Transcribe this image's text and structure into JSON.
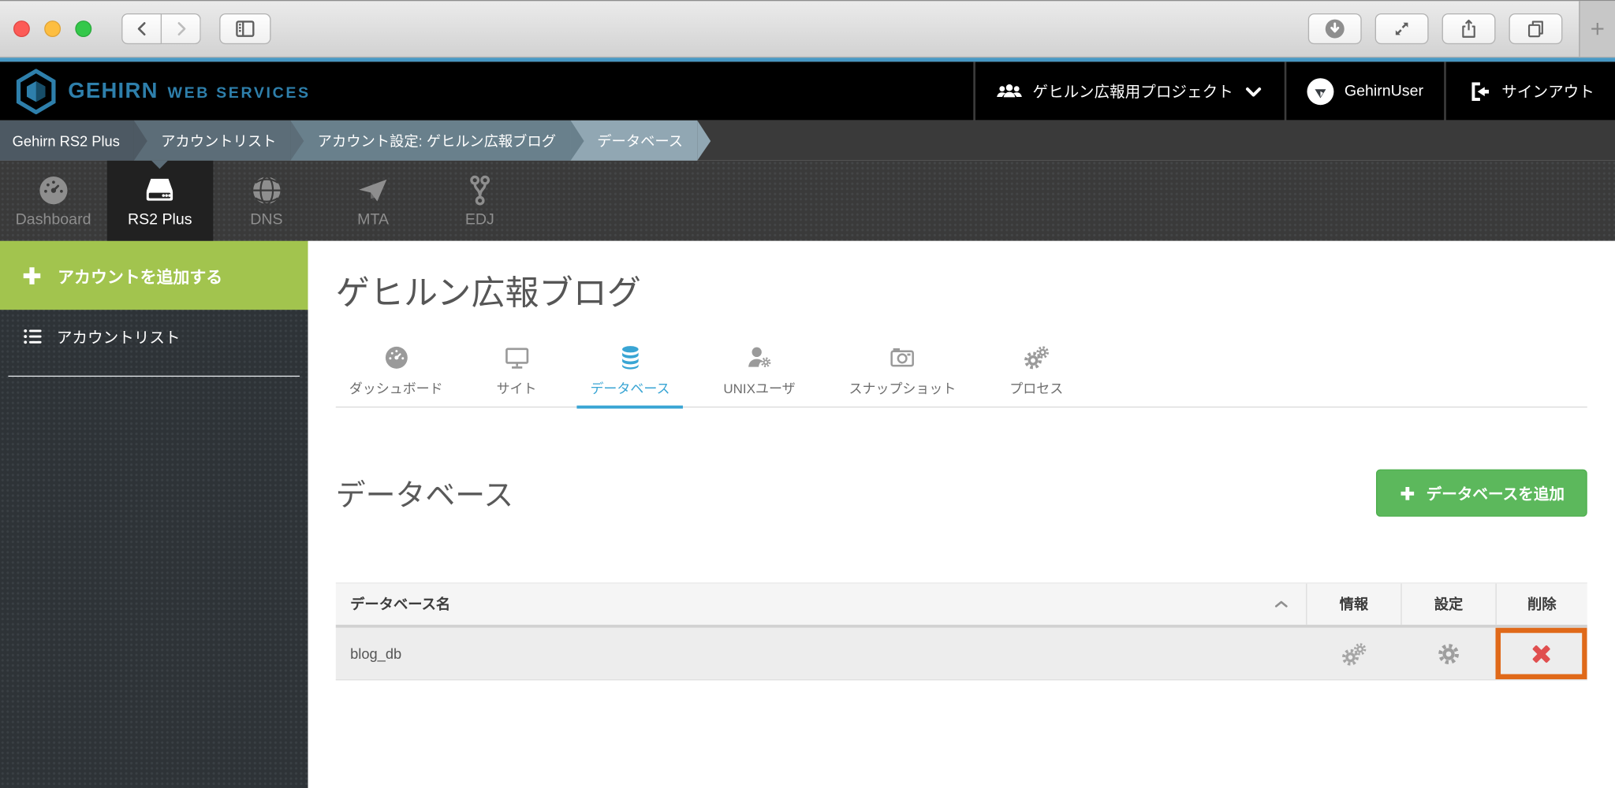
{
  "header": {
    "brand": "GEHIRN",
    "brand_suffix": "WEB SERVICES",
    "project_label": "ゲヒルン広報用プロジェクト",
    "user_name": "GehirnUser",
    "signout_label": "サインアウト"
  },
  "breadcrumb": {
    "items": [
      {
        "label": "Gehirn RS2 Plus"
      },
      {
        "label": "アカウントリスト"
      },
      {
        "label": "アカウント設定: ゲヒルン広報ブログ"
      },
      {
        "label": "データベース"
      }
    ]
  },
  "nav": {
    "items": [
      {
        "label": "Dashboard",
        "icon": "gauge-icon",
        "active": false
      },
      {
        "label": "RS2 Plus",
        "icon": "server-icon",
        "active": true
      },
      {
        "label": "DNS",
        "icon": "globe-icon",
        "active": false
      },
      {
        "label": "MTA",
        "icon": "paper-plane-icon",
        "active": false
      },
      {
        "label": "EDJ",
        "icon": "git-branch-icon",
        "active": false
      }
    ]
  },
  "sidebar": {
    "add_account_label": "アカウントを追加する",
    "account_list_label": "アカウントリスト"
  },
  "main": {
    "page_title": "ゲヒルン広報ブログ",
    "tabs": [
      {
        "label": "ダッシュボード",
        "icon": "gauge-icon",
        "active": false
      },
      {
        "label": "サイト",
        "icon": "monitor-icon",
        "active": false
      },
      {
        "label": "データベース",
        "icon": "database-icon",
        "active": true
      },
      {
        "label": "UNIXユーザ",
        "icon": "user-gear-icon",
        "active": false
      },
      {
        "label": "スナップショット",
        "icon": "camera-icon",
        "active": false
      },
      {
        "label": "プロセス",
        "icon": "gears-icon",
        "active": false
      }
    ],
    "section_heading": "データベース",
    "add_database_button": "データベースを追加",
    "table": {
      "name_column_header": "データベース名",
      "action_columns": [
        "情報",
        "設定",
        "削除"
      ],
      "rows": [
        {
          "name": "blog_db",
          "actions": [
            "info-gears-icon",
            "settings-gear-icon",
            "delete-x-icon"
          ],
          "delete_highlighted": true
        }
      ]
    }
  },
  "colors": {
    "accent_blue": "#4798c4",
    "brand_blue": "#2e7fab",
    "sidebar_green": "#a2c44e",
    "button_green": "#5cb85c",
    "active_tab_blue": "#39a5d4",
    "highlight_orange": "#e06919",
    "delete_red": "#e04f4f"
  }
}
